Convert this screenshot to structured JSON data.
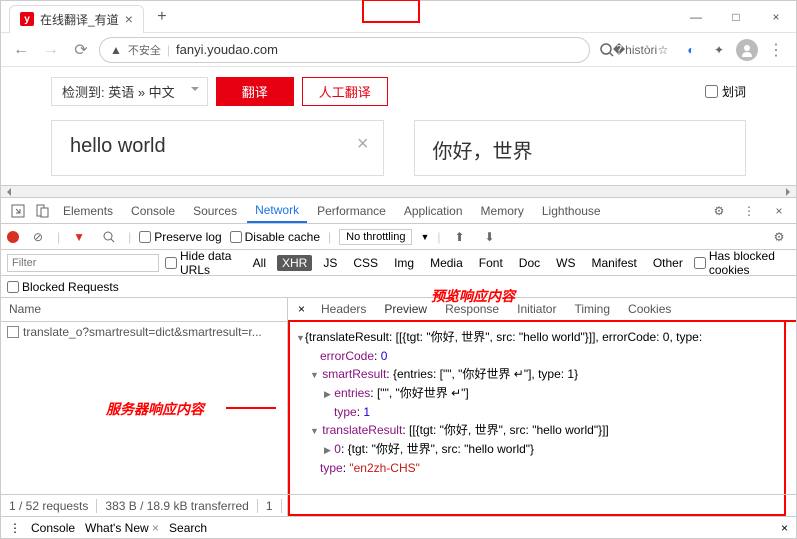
{
  "window": {
    "title": "在线翻译_有道",
    "newtab": "+"
  },
  "nav": {
    "security": "不安全",
    "url": "fanyi.youdao.com"
  },
  "page": {
    "lang_detect": "检测到: 英语 » 中文",
    "translate_btn": "翻译",
    "human_btn": "人工翻译",
    "scribe": "划词",
    "src_text": "hello world",
    "tgt_text": "你好，世界"
  },
  "devtools": {
    "tabs": {
      "elements": "Elements",
      "console": "Console",
      "sources": "Sources",
      "network": "Network",
      "performance": "Performance",
      "application": "Application",
      "memory": "Memory",
      "lighthouse": "Lighthouse"
    },
    "toolbar": {
      "preserve": "Preserve log",
      "disable": "Disable cache",
      "throttle": "No throttling"
    },
    "filter": {
      "placeholder": "Filter",
      "hideurls": "Hide data URLs",
      "all": "All",
      "xhr": "XHR",
      "js": "JS",
      "css": "CSS",
      "img": "Img",
      "media": "Media",
      "font": "Font",
      "doc": "Doc",
      "ws": "WS",
      "manifest": "Manifest",
      "other": "Other",
      "blockedcookies": "Has blocked cookies",
      "blockedreq": "Blocked Requests"
    },
    "name_hdr": "Name",
    "request": "translate_o?smartresult=dict&smartresult=r...",
    "detail_tabs": {
      "headers": "Headers",
      "preview": "Preview",
      "response": "Response",
      "initiator": "Initiator",
      "timing": "Timing",
      "cookies": "Cookies"
    },
    "status": {
      "reqs": "1 / 52 requests",
      "xfer": "383 B / 18.9 kB transferred",
      "res": "1"
    },
    "drawer": {
      "console": "Console",
      "whatsnew": "What's New",
      "search": "Search"
    }
  },
  "json_preview": {
    "line1a": "{translateResult: [[{tgt: \"",
    "line1tgt": "你好, 世界",
    "line1b": "\", src: \"",
    "line1src": "hello world",
    "line1c": "\"}]], errorCode: 0, type:",
    "line2k": "errorCode",
    "line2v": "0",
    "line3k": "smartResult",
    "line3v": "{entries: [\"\", \"你好世界 ↵\"], type: 1}",
    "line4k": "entries",
    "line4v": "[\"\", \"你好世界 ↵\"]",
    "line5k": "type",
    "line5v": "1",
    "line6k": "translateResult",
    "line6v": "[[{tgt: \"你好, 世界\", src: \"hello world\"}]]",
    "line7k": "0",
    "line7v": "{tgt: \"你好, 世界\", src: \"hello world\"}",
    "line8k": "type",
    "line8v": "\"en2zh-CHS\""
  },
  "annotations": {
    "preview": "预览响应内容",
    "server": "服务器响应内容"
  }
}
